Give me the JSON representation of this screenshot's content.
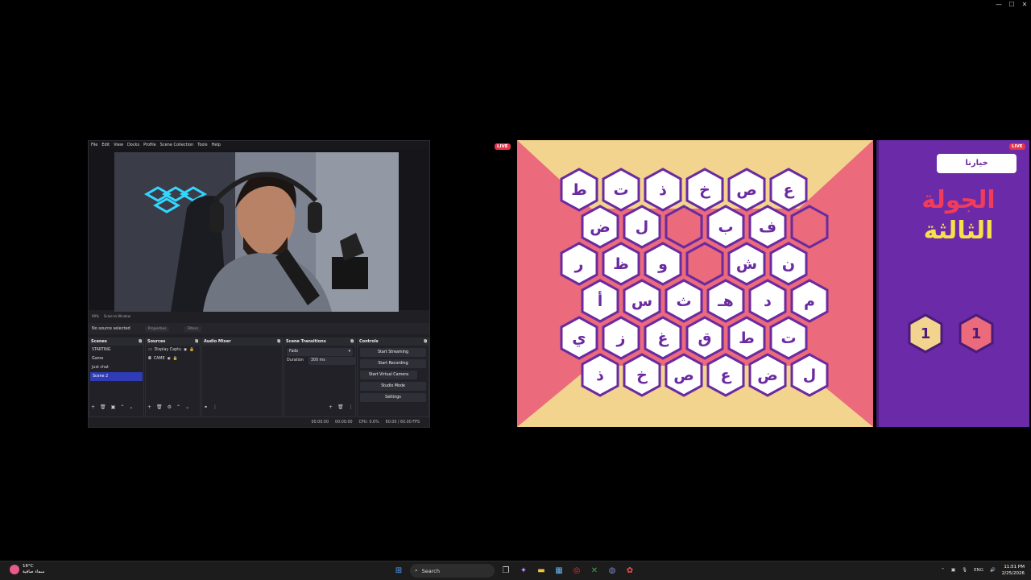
{
  "window_controls": {
    "minimize": "—",
    "maximize": "☐",
    "close": "✕"
  },
  "obs": {
    "menu": [
      "File",
      "Edit",
      "View",
      "Docks",
      "Profile",
      "Scene Collection",
      "Tools",
      "Help"
    ],
    "zoom": "99%",
    "scale_mode": "Scale to Window",
    "no_source": "No source selected",
    "properties_btn": "Properties",
    "filters_btn": "Filters",
    "docks": {
      "scenes_title": "Scenes",
      "scenes": [
        "STARTING",
        "Game",
        "Just chat",
        "Scene 2"
      ],
      "selected_scene": 3,
      "sources_title": "Sources",
      "sources": [
        "Display Captu",
        "CAME"
      ],
      "mixer_title": "Audio Mixer",
      "transitions_title": "Scene Transitions",
      "transition": "Fade",
      "duration_label": "Duration",
      "duration_value": "300 ms",
      "controls_title": "Controls",
      "controls": [
        "Start Streaming",
        "Start Recording",
        "Start Virtual Camera",
        "Studio Mode",
        "Settings"
      ]
    },
    "status": {
      "stream_time": "00:00:00",
      "rec_time": "00:00:00",
      "cpu": "CPU: 0.6%",
      "fps": "60.00 / 60.00 FPS"
    }
  },
  "game": {
    "live_label": "LIVE",
    "team_name": "خيارنا",
    "round_line1": "الجولة",
    "round_line2": "الثالثة",
    "score_left": "1",
    "score_right": "1",
    "colors": {
      "board_pink": "#eb6a7c",
      "board_cream": "#f2d48e",
      "purple": "#6b2aa8",
      "hex_border": "#6a2aa0"
    },
    "rows": [
      [
        "ط",
        "ت",
        "ذ",
        "خ",
        "ص",
        "ع"
      ],
      [
        "ض",
        "ل",
        "",
        "ب",
        "ف",
        ""
      ],
      [
        "ر",
        "ظ",
        "و",
        "",
        "ش",
        "ن"
      ],
      [
        "أ",
        "س",
        "ث",
        "هـ",
        "د",
        "م"
      ],
      [
        "ي",
        "ز",
        "غ",
        "ق",
        "ط",
        "ت"
      ],
      [
        "ذ",
        "خ",
        "ص",
        "ع",
        "ض",
        "ل"
      ]
    ]
  },
  "taskbar": {
    "temp": "16°C",
    "weather_desc": "سماء صافية",
    "search": "Search",
    "lang": "ENG",
    "time": "11:51 PM",
    "date": "2/25/2026"
  }
}
